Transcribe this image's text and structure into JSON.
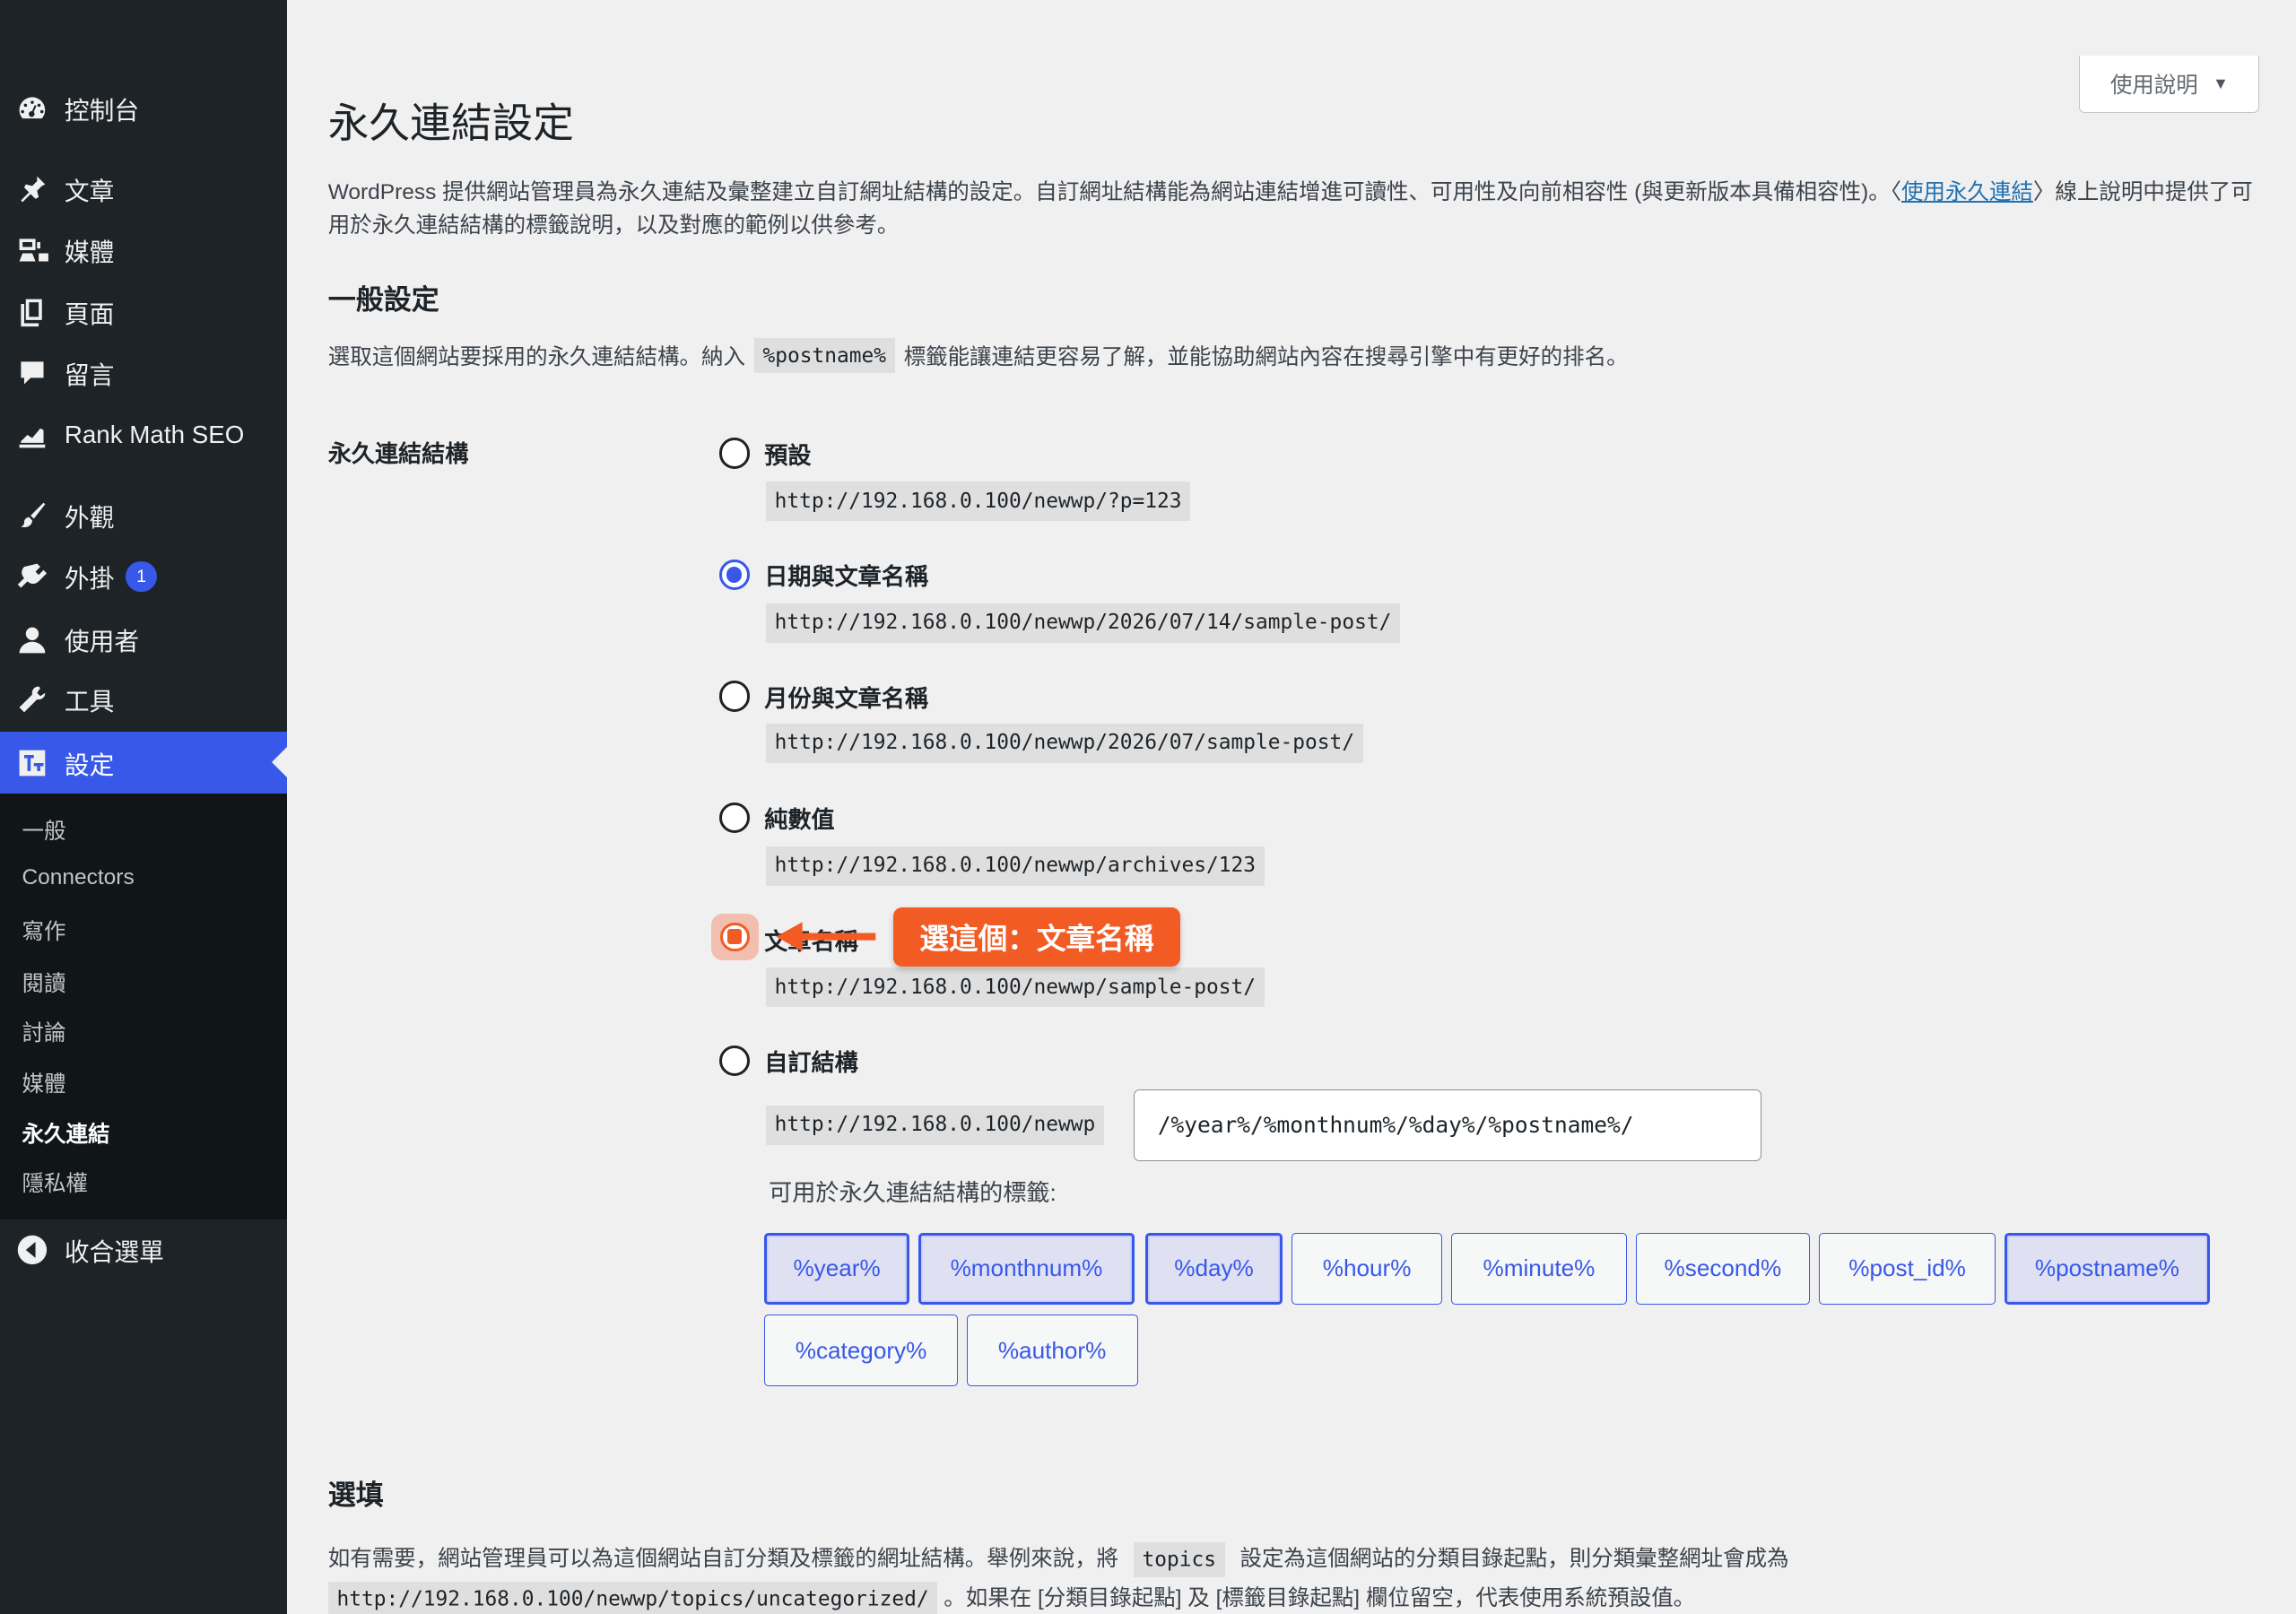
{
  "sidebar": {
    "items": [
      {
        "label": "控制台",
        "icon": "dashboard-icon"
      },
      {
        "label": "文章",
        "icon": "pin-icon"
      },
      {
        "label": "媒體",
        "icon": "media-icon"
      },
      {
        "label": "頁面",
        "icon": "pages-icon"
      },
      {
        "label": "留言",
        "icon": "comment-icon"
      },
      {
        "label": "Rank Math SEO",
        "icon": "rank-math-icon"
      },
      {
        "label": "外觀",
        "icon": "brush-icon"
      },
      {
        "label": "外掛",
        "icon": "plugin-icon",
        "badge": "1"
      },
      {
        "label": "使用者",
        "icon": "user-icon"
      },
      {
        "label": "工具",
        "icon": "wrench-icon"
      },
      {
        "label": "設定",
        "icon": "settings-icon"
      }
    ],
    "submenu": [
      "一般",
      "Connectors",
      "寫作",
      "閱讀",
      "討論",
      "媒體",
      "永久連結",
      "隱私權"
    ],
    "collapse_label": "收合選單"
  },
  "help_button": "使用說明",
  "page_title": "永久連結設定",
  "intro": {
    "text_before": "WordPress 提供網站管理員為永久連結及彙整建立自訂網址結構的設定。自訂網址結構能為網站連結增進可讀性、可用性及向前相容性 (與更新版本具備相容性)。〈",
    "link": "使用永久連結",
    "text_after": "〉線上說明中提供了可用於永久連結結構的標籤說明，以及對應的範例以供參考。"
  },
  "general": {
    "heading": "一般設定",
    "desc_before": "選取這個網站要採用的永久連結結構。納入",
    "desc_code": "%postname%",
    "desc_after": "標籤能讓連結更容易了解，並能協助網站內容在搜尋引擎中有更好的排名。"
  },
  "structure_label": "永久連結結構",
  "options": [
    {
      "label": "預設",
      "sample": "http://192.168.0.100/newwp/?p=123",
      "checked": false
    },
    {
      "label": "日期與文章名稱",
      "sample": "http://192.168.0.100/newwp/2026/07/14/sample-post/",
      "checked": true
    },
    {
      "label": "月份與文章名稱",
      "sample": "http://192.168.0.100/newwp/2026/07/sample-post/",
      "checked": false
    },
    {
      "label": "純數值",
      "sample": "http://192.168.0.100/newwp/archives/123",
      "checked": false
    },
    {
      "label": "文章名稱",
      "sample": "http://192.168.0.100/newwp/sample-post/",
      "checked": false
    },
    {
      "label": "自訂結構",
      "sample": "http://192.168.0.100/newwp",
      "checked": false
    }
  ],
  "callout": "選這個：文章名稱",
  "custom_structure_value": "/%year%/%monthnum%/%day%/%postname%/",
  "tags_label": "可用於永久連結結構的標籤:",
  "tags": [
    "%year%",
    "%monthnum%",
    "%day%",
    "%hour%",
    "%minute%",
    "%second%",
    "%post_id%",
    "%postname%",
    "%category%",
    "%author%"
  ],
  "optional": {
    "heading": "選填",
    "desc_before": "如有需要，網站管理員可以為這個網站自訂分類及標籤的網址結構。舉例來說，將",
    "desc_code": "topics",
    "desc_after": "設定為這個網站的分類目錄起點，則分類彙整網址會成為",
    "url_code": "http://192.168.0.100/newwp/topics/uncategorized/",
    "desc_end": "。如果在 [分類目錄起點] 及 [標籤目錄起點] 欄位留空，代表使用系統預設值。"
  },
  "colors": {
    "accent": "#3858e9",
    "sidebar_bg": "#1d2327",
    "callout": "#f25c24"
  }
}
